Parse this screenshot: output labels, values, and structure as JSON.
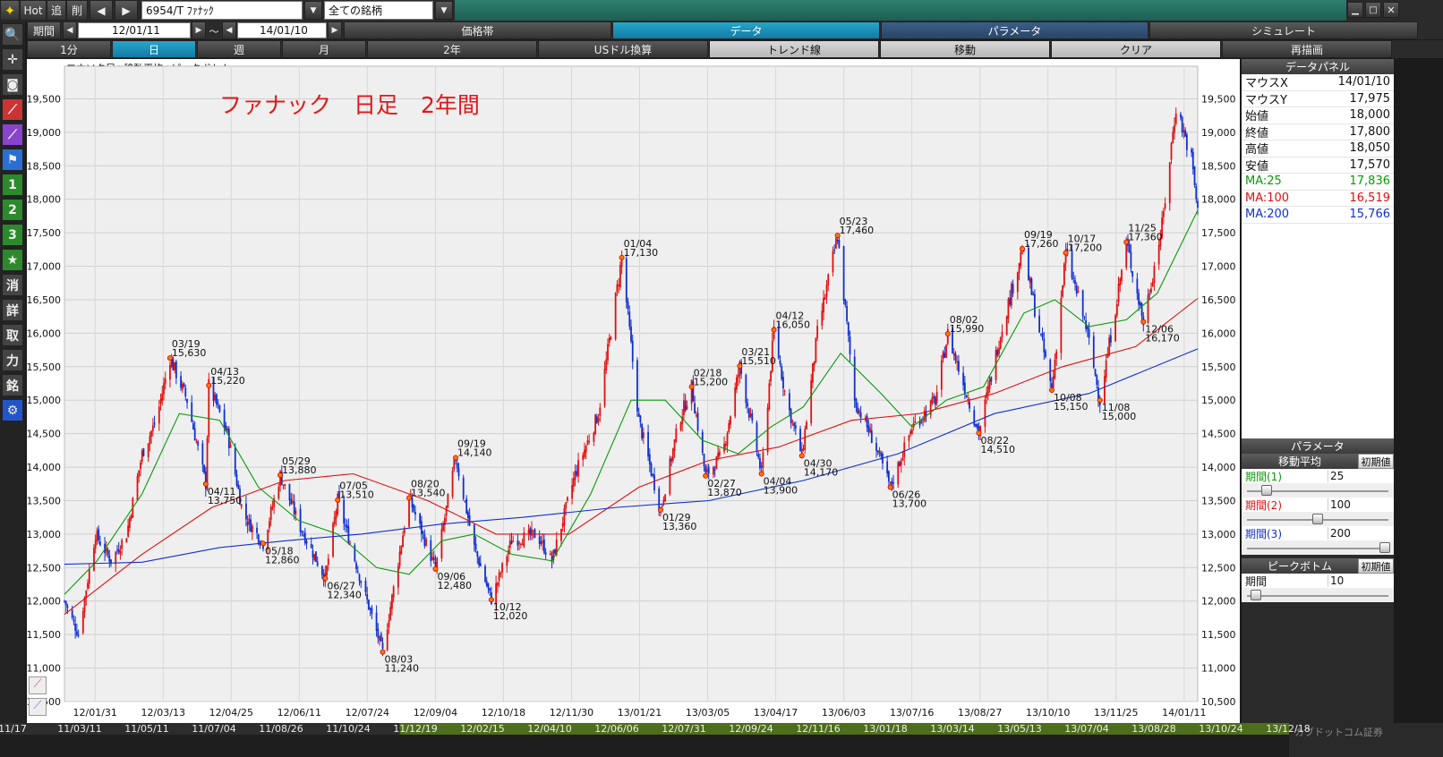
{
  "toolbar": {
    "hot": "Hot",
    "add": "追",
    "delete": "削",
    "symbol": "6954/T ﾌｧﾅｯｸ",
    "filter": "全ての銘柄"
  },
  "period": {
    "label": "期間",
    "from": "12/01/11",
    "sep": "～",
    "to": "14/01/10"
  },
  "top_tabs": [
    "価格帯",
    "データ",
    "パラメータ",
    "シミュレート"
  ],
  "second_tabs": [
    "1分",
    "日",
    "週",
    "月",
    "2年",
    "USドル換算",
    "トレンド線",
    "移動",
    "クリア",
    "再描画"
  ],
  "side_tools": [
    {
      "name": "search-icon",
      "glyph": "🔍"
    },
    {
      "name": "crosshair-icon",
      "glyph": "✛"
    },
    {
      "name": "camera-icon",
      "glyph": "◙"
    },
    {
      "name": "chart-red-icon",
      "glyph": "⟋"
    },
    {
      "name": "chart-purple-icon",
      "glyph": "⟋"
    },
    {
      "name": "flag-icon",
      "glyph": "⚑"
    },
    {
      "name": "tool-1",
      "glyph": "1"
    },
    {
      "name": "tool-2",
      "glyph": "2"
    },
    {
      "name": "tool-3",
      "glyph": "3"
    },
    {
      "name": "star-icon",
      "glyph": "★"
    },
    {
      "name": "tool-erase",
      "glyph": "消"
    },
    {
      "name": "tool-detail",
      "glyph": "詳"
    },
    {
      "name": "tool-get",
      "glyph": "取"
    },
    {
      "name": "tool-input",
      "glyph": "力"
    },
    {
      "name": "tool-brand",
      "glyph": "銘"
    },
    {
      "name": "gear-icon",
      "glyph": "⚙"
    }
  ],
  "chart_header": "ロウソク足+移動平均+ピークボトム",
  "data_panel": {
    "title": "データパネル",
    "rows": [
      {
        "k": "マウスX",
        "v": "14/01/10"
      },
      {
        "k": "マウスY",
        "v": "17,975"
      },
      {
        "k": "始値",
        "v": "18,000"
      },
      {
        "k": "終値",
        "v": "17,800"
      },
      {
        "k": "高値",
        "v": "18,050"
      },
      {
        "k": "安値",
        "v": "17,570"
      },
      {
        "k": "MA:25",
        "v": "17,836",
        "c": "#0a9a0a"
      },
      {
        "k": "MA:100",
        "v": "16,519",
        "c": "#e01010"
      },
      {
        "k": "MA:200",
        "v": "15,766",
        "c": "#1030d0"
      }
    ]
  },
  "params": {
    "title": "パラメータ",
    "ma_label": "移動平均",
    "reset": "初期値",
    "rows": [
      {
        "k": "期間(1)",
        "v": "25",
        "c": "#0a9a0a",
        "pos": 0.12
      },
      {
        "k": "期間(2)",
        "v": "100",
        "c": "#e01010",
        "pos": 0.5
      },
      {
        "k": "期間(3)",
        "v": "200",
        "c": "#1030d0",
        "pos": 1.0
      }
    ],
    "pb_title": "ピークボトム",
    "pb_reset": "初期値",
    "pb_row": {
      "k": "期間",
      "v": "10",
      "pos": 0.04
    }
  },
  "timeline_labels": [
    "11/17",
    "11/03/11",
    "11/05/11",
    "11/07/04",
    "11/08/26",
    "11/10/24",
    "11/12/19",
    "12/02/15",
    "12/04/10",
    "12/06/06",
    "12/07/31",
    "12/09/24",
    "12/11/16",
    "13/01/18",
    "13/03/14",
    "13/05/13",
    "13/07/04",
    "13/08/28",
    "13/10/24",
    "13/12/18"
  ],
  "timeline_right": "カブドットコム証券",
  "chart_data": {
    "type": "candlestick",
    "title": "ファナック　日足　2年間",
    "ylim": [
      10500,
      19800
    ],
    "yticks": [
      10500,
      11000,
      11500,
      12000,
      12500,
      13000,
      13500,
      14000,
      14500,
      15000,
      15500,
      16000,
      16500,
      17000,
      17500,
      18000,
      18500,
      19000,
      19500
    ],
    "xlabels": [
      "12/01/31",
      "12/03/13",
      "12/04/25",
      "12/06/11",
      "12/07/24",
      "12/09/04",
      "12/10/18",
      "12/11/30",
      "13/01/21",
      "13/03/05",
      "13/04/17",
      "13/06/03",
      "13/07/16",
      "13/08/27",
      "13/10/10",
      "13/11/25",
      "14/01/11"
    ],
    "x_range": [
      "12/01/11",
      "14/01/10"
    ],
    "price_path": [
      [
        "12/01/11",
        12000
      ],
      [
        "12/01/20",
        11500
      ],
      [
        "12/01/31",
        13000
      ],
      [
        "12/02/10",
        12600
      ],
      [
        "12/02/20",
        13000
      ],
      [
        "12/03/01",
        14200
      ],
      [
        "12/03/10",
        14700
      ],
      [
        "12/03/19",
        15630
      ],
      [
        "12/03/30",
        15000
      ],
      [
        "12/04/11",
        13750
      ],
      [
        "12/04/13",
        15220
      ],
      [
        "12/04/25",
        14500
      ],
      [
        "12/05/05",
        13300
      ],
      [
        "12/05/18",
        12860
      ],
      [
        "12/05/29",
        13880
      ],
      [
        "12/06/11",
        13100
      ],
      [
        "12/06/27",
        12340
      ],
      [
        "12/07/05",
        13510
      ],
      [
        "12/07/20",
        12300
      ],
      [
        "12/08/03",
        11240
      ],
      [
        "12/08/20",
        13540
      ],
      [
        "12/09/06",
        12480
      ],
      [
        "12/09/19",
        14140
      ],
      [
        "12/10/01",
        12800
      ],
      [
        "12/10/12",
        12020
      ],
      [
        "12/10/25",
        12900
      ],
      [
        "12/11/10",
        13000
      ],
      [
        "12/11/20",
        12600
      ],
      [
        "12/12/05",
        13900
      ],
      [
        "12/12/20",
        14800
      ],
      [
        "13/01/04",
        17130
      ],
      [
        "13/01/15",
        14700
      ],
      [
        "13/01/29",
        13360
      ],
      [
        "13/02/10",
        14700
      ],
      [
        "13/02/18",
        15200
      ],
      [
        "13/02/27",
        13870
      ],
      [
        "13/03/10",
        14200
      ],
      [
        "13/03/21",
        15510
      ],
      [
        "13/04/04",
        13900
      ],
      [
        "13/04/12",
        16050
      ],
      [
        "13/04/20",
        15000
      ],
      [
        "13/04/30",
        14170
      ],
      [
        "13/05/10",
        16000
      ],
      [
        "13/05/23",
        17460
      ],
      [
        "13/06/03",
        15000
      ],
      [
        "13/06/15",
        14400
      ],
      [
        "13/06/26",
        13700
      ],
      [
        "13/07/10",
        14600
      ],
      [
        "13/07/25",
        15000
      ],
      [
        "13/08/02",
        15990
      ],
      [
        "13/08/22",
        14510
      ],
      [
        "13/09/05",
        16000
      ],
      [
        "13/09/19",
        17260
      ],
      [
        "13/10/08",
        15150
      ],
      [
        "13/10/17",
        17200
      ],
      [
        "13/10/30",
        16100
      ],
      [
        "13/11/08",
        15000
      ],
      [
        "13/11/25",
        17360
      ],
      [
        "13/12/06",
        16170
      ],
      [
        "13/12/18",
        17600
      ],
      [
        "13/12/27",
        19400
      ],
      [
        "14/01/06",
        18600
      ],
      [
        "14/01/10",
        17800
      ]
    ],
    "ma_series": [
      {
        "name": "MA:25",
        "color": "#0a9a0a",
        "points": [
          [
            "12/01/11",
            12100
          ],
          [
            "12/02/01",
            12600
          ],
          [
            "12/03/01",
            13600
          ],
          [
            "12/03/25",
            14800
          ],
          [
            "12/04/20",
            14700
          ],
          [
            "12/05/15",
            13700
          ],
          [
            "12/06/10",
            13200
          ],
          [
            "12/07/05",
            13000
          ],
          [
            "12/07/30",
            12500
          ],
          [
            "12/08/20",
            12400
          ],
          [
            "12/09/10",
            12900
          ],
          [
            "12/10/01",
            13000
          ],
          [
            "12/10/25",
            12700
          ],
          [
            "12/11/20",
            12600
          ],
          [
            "12/12/15",
            13600
          ],
          [
            "13/01/10",
            15000
          ],
          [
            "13/02/01",
            15000
          ],
          [
            "13/02/25",
            14400
          ],
          [
            "13/03/20",
            14200
          ],
          [
            "13/04/10",
            14600
          ],
          [
            "13/05/01",
            14900
          ],
          [
            "13/05/25",
            15700
          ],
          [
            "13/06/20",
            15100
          ],
          [
            "13/07/10",
            14600
          ],
          [
            "13/08/01",
            15000
          ],
          [
            "13/08/25",
            15200
          ],
          [
            "13/09/20",
            16300
          ],
          [
            "13/10/10",
            16500
          ],
          [
            "13/11/01",
            16100
          ],
          [
            "13/11/25",
            16200
          ],
          [
            "13/12/15",
            16600
          ],
          [
            "14/01/10",
            17836
          ]
        ]
      },
      {
        "name": "MA:100",
        "color": "#e01010",
        "points": [
          [
            "12/01/11",
            11800
          ],
          [
            "12/03/01",
            12700
          ],
          [
            "12/04/15",
            13400
          ],
          [
            "12/06/01",
            13800
          ],
          [
            "12/07/15",
            13900
          ],
          [
            "12/09/01",
            13500
          ],
          [
            "12/10/15",
            13000
          ],
          [
            "12/12/01",
            13000
          ],
          [
            "13/01/15",
            13700
          ],
          [
            "13/03/01",
            14100
          ],
          [
            "13/04/15",
            14300
          ],
          [
            "13/06/01",
            14700
          ],
          [
            "13/07/15",
            14800
          ],
          [
            "13/09/01",
            15100
          ],
          [
            "13/10/15",
            15500
          ],
          [
            "13/12/01",
            15800
          ],
          [
            "14/01/10",
            16519
          ]
        ]
      },
      {
        "name": "MA:200",
        "color": "#1030d0",
        "points": [
          [
            "12/01/11",
            12550
          ],
          [
            "12/03/01",
            12580
          ],
          [
            "12/04/20",
            12800
          ],
          [
            "12/06/01",
            12900
          ],
          [
            "12/07/20",
            13000
          ],
          [
            "12/09/10",
            13150
          ],
          [
            "12/11/01",
            13250
          ],
          [
            "13/01/01",
            13400
          ],
          [
            "13/03/01",
            13500
          ],
          [
            "13/05/01",
            13800
          ],
          [
            "13/07/01",
            14200
          ],
          [
            "13/09/01",
            14800
          ],
          [
            "13/11/01",
            15100
          ],
          [
            "14/01/10",
            15766
          ]
        ]
      }
    ],
    "peaks": [
      {
        "date": "12/03/19",
        "price": 15630,
        "label": "03/19",
        "value": "15,630",
        "pos": "top"
      },
      {
        "date": "12/04/13",
        "price": 15220,
        "label": "04/13",
        "value": "15,220",
        "pos": "top"
      },
      {
        "date": "12/04/11",
        "price": 13750,
        "label": "04/11",
        "value": "13,750",
        "pos": "bottom"
      },
      {
        "date": "12/05/29",
        "price": 13880,
        "label": "05/29",
        "value": "13,880",
        "pos": "top"
      },
      {
        "date": "12/05/18",
        "price": 12860,
        "label": "05/18",
        "value": "12,860",
        "pos": "bottom"
      },
      {
        "date": "12/07/05",
        "price": 13510,
        "label": "07/05",
        "value": "13,510",
        "pos": "top"
      },
      {
        "date": "12/06/27",
        "price": 12340,
        "label": "06/27",
        "value": "12,340",
        "pos": "bottom"
      },
      {
        "date": "12/08/03",
        "price": 11240,
        "label": "08/03",
        "value": "11,240",
        "pos": "bottom"
      },
      {
        "date": "12/08/20",
        "price": 13540,
        "label": "08/20",
        "value": "13,540",
        "pos": "top"
      },
      {
        "date": "12/09/06",
        "price": 12480,
        "label": "09/06",
        "value": "12,480",
        "pos": "bottom"
      },
      {
        "date": "12/09/19",
        "price": 14140,
        "label": "09/19",
        "value": "14,140",
        "pos": "top"
      },
      {
        "date": "12/10/12",
        "price": 12020,
        "label": "10/12",
        "value": "12,020",
        "pos": "bottom"
      },
      {
        "date": "13/01/04",
        "price": 17130,
        "label": "01/04",
        "value": "17,130",
        "pos": "top"
      },
      {
        "date": "13/01/29",
        "price": 13360,
        "label": "01/29",
        "value": "13,360",
        "pos": "bottom"
      },
      {
        "date": "13/02/18",
        "price": 15200,
        "label": "02/18",
        "value": "15,200",
        "pos": "top"
      },
      {
        "date": "13/02/27",
        "price": 13870,
        "label": "02/27",
        "value": "13,870",
        "pos": "bottom"
      },
      {
        "date": "13/03/21",
        "price": 15510,
        "label": "03/21",
        "value": "15,510",
        "pos": "top"
      },
      {
        "date": "13/04/04",
        "price": 13900,
        "label": "04/04",
        "value": "13,900",
        "pos": "bottom"
      },
      {
        "date": "13/04/12",
        "price": 16050,
        "label": "04/12",
        "value": "16,050",
        "pos": "top"
      },
      {
        "date": "13/04/30",
        "price": 14170,
        "label": "04/30",
        "value": "14,170",
        "pos": "bottom"
      },
      {
        "date": "13/05/23",
        "price": 17460,
        "label": "05/23",
        "value": "17,460",
        "pos": "top"
      },
      {
        "date": "13/06/26",
        "price": 13700,
        "label": "06/26",
        "value": "13,700",
        "pos": "bottom"
      },
      {
        "date": "13/08/02",
        "price": 15990,
        "label": "08/02",
        "value": "15,990",
        "pos": "top"
      },
      {
        "date": "13/08/22",
        "price": 14510,
        "label": "08/22",
        "value": "14,510",
        "pos": "bottom"
      },
      {
        "date": "13/09/19",
        "price": 17260,
        "label": "09/19",
        "value": "17,260",
        "pos": "top"
      },
      {
        "date": "13/10/08",
        "price": 15150,
        "label": "10/08",
        "value": "15,150",
        "pos": "bottom"
      },
      {
        "date": "13/10/17",
        "price": 17200,
        "label": "10/17",
        "value": "17,200",
        "pos": "top"
      },
      {
        "date": "13/11/08",
        "price": 15000,
        "label": "11/08",
        "value": "15,000",
        "pos": "bottom"
      },
      {
        "date": "13/11/25",
        "price": 17360,
        "label": "11/25",
        "value": "17,360",
        "pos": "top"
      },
      {
        "date": "13/12/06",
        "price": 16170,
        "label": "12/06",
        "value": "16,170",
        "pos": "bottom"
      }
    ]
  }
}
